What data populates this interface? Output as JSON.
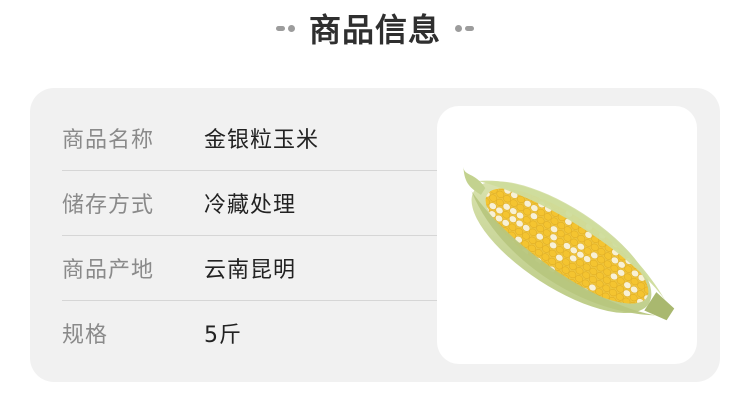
{
  "header": {
    "title": "商品信息"
  },
  "product_info": {
    "rows": [
      {
        "label": "商品名称",
        "value": "金银粒玉米"
      },
      {
        "label": "储存方式",
        "value": "冷藏处理"
      },
      {
        "label": "商品产地",
        "value": "云南昆明"
      },
      {
        "label": "规格",
        "value": "5斤"
      }
    ]
  },
  "image": {
    "subject": "corn-cob",
    "colors": {
      "kernel_yellow": "#f4c430",
      "kernel_white": "#f8f1d6",
      "husk_green": "#c9d79a"
    }
  },
  "colors": {
    "page_background": "#ffffff",
    "card_background": "#f1f1f1",
    "label_text": "#8a8a8a",
    "value_text": "#222222",
    "title_text": "#2f2f2f"
  }
}
